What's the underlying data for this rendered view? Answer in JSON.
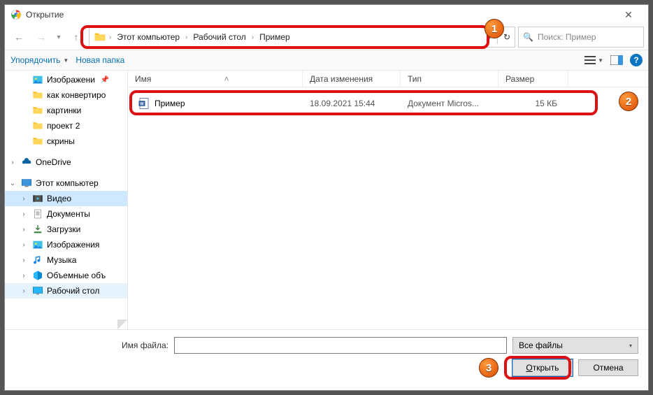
{
  "title": "Открытие",
  "breadcrumbs": [
    "Этот компьютер",
    "Рабочий стол",
    "Пример"
  ],
  "search_placeholder": "Поиск: Пример",
  "toolbar": {
    "organize": "Упорядочить",
    "new_folder": "Новая папка"
  },
  "columns": {
    "name": "Имя",
    "date": "Дата изменения",
    "type": "Тип",
    "size": "Размер"
  },
  "file": {
    "name": "Пример",
    "date": "18.09.2021 15:44",
    "type": "Документ Micros...",
    "size": "15 КБ"
  },
  "sidebar": [
    {
      "icon": "pictures",
      "label": "Изображени",
      "pin": true,
      "indent": 1
    },
    {
      "icon": "folder",
      "label": "как конвертиро",
      "indent": 1
    },
    {
      "icon": "folder",
      "label": "картинки",
      "indent": 1
    },
    {
      "icon": "folder",
      "label": "проект 2",
      "indent": 1
    },
    {
      "icon": "folder",
      "label": "скрины",
      "indent": 1
    },
    {
      "spacer": true
    },
    {
      "icon": "onedrive",
      "label": "OneDrive",
      "twisty": ">",
      "indent": 0
    },
    {
      "spacer": true
    },
    {
      "icon": "thispc",
      "label": "Этот компьютер",
      "twisty": "v",
      "indent": 0
    },
    {
      "icon": "video",
      "label": "Видео",
      "twisty": ">",
      "indent": 1,
      "sel": true
    },
    {
      "icon": "docs",
      "label": "Документы",
      "twisty": ">",
      "indent": 1
    },
    {
      "icon": "downloads",
      "label": "Загрузки",
      "twisty": ">",
      "indent": 1
    },
    {
      "icon": "pictures",
      "label": "Изображения",
      "twisty": ">",
      "indent": 1
    },
    {
      "icon": "music",
      "label": "Музыка",
      "twisty": ">",
      "indent": 1
    },
    {
      "icon": "3d",
      "label": "Объемные объ",
      "twisty": ">",
      "indent": 1
    },
    {
      "icon": "desktop",
      "label": "Рабочий стол",
      "twisty": ">",
      "indent": 1,
      "hl": true
    }
  ],
  "bottom": {
    "filename_label": "Имя файла:",
    "filter": "Все файлы",
    "open": "Открыть",
    "cancel": "Отмена"
  },
  "markers": {
    "m1": "1",
    "m2": "2",
    "m3": "3"
  }
}
